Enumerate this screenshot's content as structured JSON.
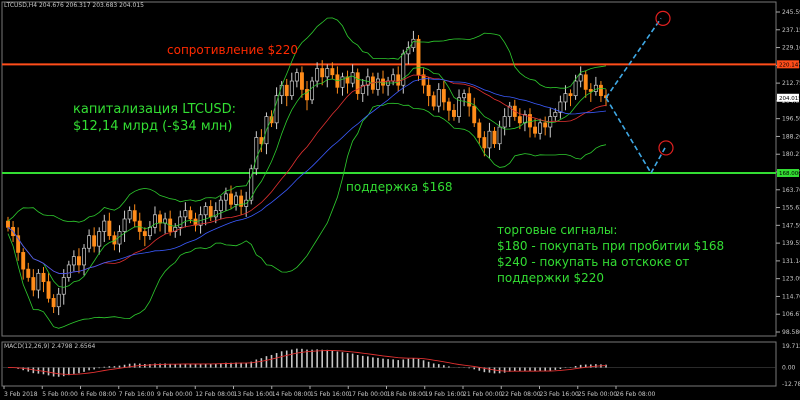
{
  "header": {
    "symbol_line": "LTCUSD,H4  204.676 206.317 203.683 204.015",
    "macd_line": "MACD(12,26,9) 2.4798 2.6564"
  },
  "annotations": {
    "resistance": "сопротивление $220",
    "support": "поддержка $168",
    "cap_title": "капитализация LTCUSD:",
    "cap_value": "$12,14 млрд (-$34 млн)",
    "signals_title": "торговые сигналы:",
    "signal_1": "$180 - покупать при пробитии $168",
    "signal_2": "$240 - покупать на отскоке от",
    "signal_3": "поддержки $220"
  },
  "colors": {
    "resistance": "#ff4d1a",
    "support": "#33dd33",
    "bull_candle": "#000000",
    "bear_candle": "#ff8c1a",
    "bollinger": "#2ecc2e",
    "ma_red": "#e03030",
    "ma_blue": "#3b5bff",
    "projection": "#3fa9e6",
    "target_circle": "#e02020",
    "macd_hist": "#c8c8c8",
    "macd_signal": "#e03030"
  },
  "chart_data": {
    "type": "candlestick",
    "instrument": "LTCUSD",
    "timeframe": "H4",
    "ylim": [
      90,
      246
    ],
    "y_ticks": [
      "245.590",
      "237.150",
      "229.160",
      "221.050",
      "212.750",
      "204.015",
      "196.590",
      "188.260",
      "180.210",
      "172.090",
      "163.760",
      "155.620",
      "147.590",
      "139.550",
      "131.140",
      "123.090",
      "114.760",
      "106.670",
      "98.580"
    ],
    "price_marker_top": "220.147",
    "price_marker_current": "204.015",
    "price_marker_support": "168.000",
    "x_ticks": [
      "3 Feb 2018",
      "5 Feb 00:00",
      "6 Feb 08:00",
      "7 Feb 16:00",
      "9 Feb 00:00",
      "12 Feb 08:00",
      "13 Feb 16:00",
      "14 Feb 08:00",
      "15 Feb 16:00",
      "17 Feb 00:00",
      "18 Feb 08:00",
      "19 Feb 16:00",
      "21 Feb 00:00",
      "22 Feb 08:00",
      "23 Feb 16:00",
      "25 Feb 00:00",
      "26 Feb 08:00"
    ],
    "resistance_level": 220,
    "support_level": 168,
    "closes": [
      142,
      138,
      130,
      122,
      118,
      112,
      120,
      116,
      108,
      104,
      110,
      118,
      124,
      128,
      124,
      132,
      138,
      133,
      140,
      145,
      138,
      134,
      140,
      146,
      150,
      145,
      140,
      138,
      142,
      148,
      144,
      146,
      140,
      142,
      147,
      150,
      146,
      143,
      148,
      152,
      147,
      150,
      155,
      158,
      153,
      157,
      152,
      155,
      170,
      185,
      182,
      195,
      192,
      205,
      210,
      205,
      212,
      216,
      208,
      203,
      212,
      218,
      214,
      218,
      215,
      209,
      214,
      211,
      216,
      206,
      210,
      214,
      208,
      213,
      210,
      212,
      215,
      210,
      225,
      228,
      232,
      215,
      210,
      205,
      200,
      208,
      202,
      198,
      195,
      204,
      206,
      200,
      192,
      185,
      180,
      188,
      182,
      190,
      195,
      200,
      195,
      192,
      196,
      190,
      187,
      192,
      190,
      195,
      197,
      202,
      206,
      205,
      212,
      215,
      208,
      207,
      210,
      205,
      204
    ],
    "projection": [
      {
        "from": "26 Feb 08:00",
        "to_price": 242,
        "label": "$240"
      },
      {
        "from": "26 Feb 08:00",
        "to_price": 168,
        "then_price": 180,
        "label": "$180"
      }
    ],
    "macd": {
      "ylim": [
        -14,
        20
      ],
      "y_ticks": [
        "19.712",
        "0.00",
        "-12.7893"
      ]
    }
  }
}
